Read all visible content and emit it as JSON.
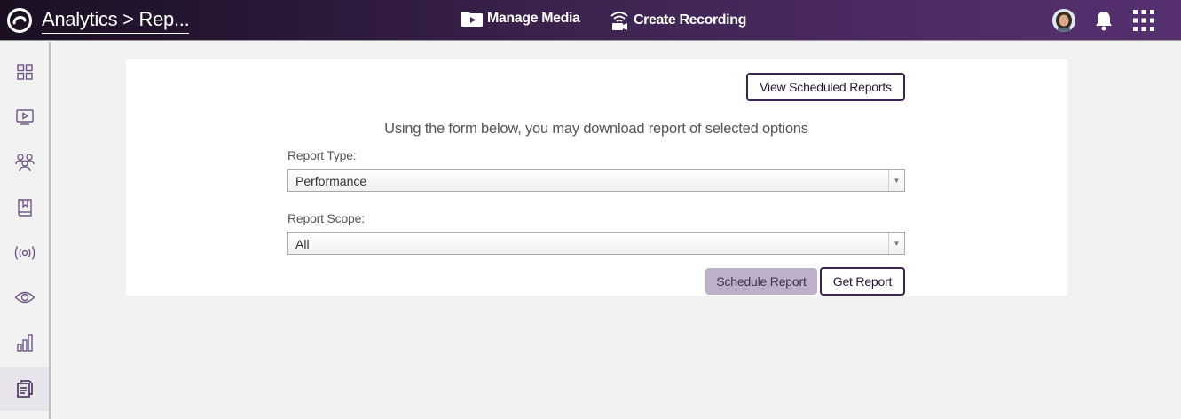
{
  "header": {
    "breadcrumb": "Analytics > Rep...",
    "manage_media": "Manage Media",
    "create_recording": "Create Recording"
  },
  "sidebar": {
    "items": [
      {
        "icon": "dashboard-icon"
      },
      {
        "icon": "media-player-icon"
      },
      {
        "icon": "groups-icon"
      },
      {
        "icon": "library-bookmark-icon"
      },
      {
        "icon": "broadcast-icon"
      },
      {
        "icon": "eye-icon"
      },
      {
        "icon": "bar-chart-icon"
      },
      {
        "icon": "reports-icon",
        "active": true
      }
    ]
  },
  "form": {
    "view_scheduled": "View Scheduled Reports",
    "intro": "Using the form below, you may download report of selected options",
    "report_type_label": "Report Type:",
    "report_type_value": "Performance",
    "report_scope_label": "Report Scope:",
    "report_scope_value": "All",
    "schedule_button": "Schedule Report",
    "get_button": "Get Report"
  },
  "colors": {
    "accent": "#3c2450",
    "disabled_button": "#bcb1c8",
    "sidebar_icon": "#6e5585"
  }
}
